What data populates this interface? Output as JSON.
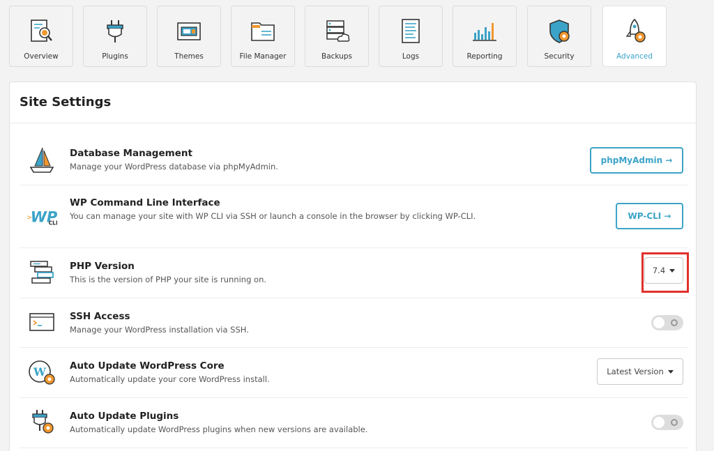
{
  "nav": {
    "tabs": [
      {
        "label": "Overview",
        "icon": "overview-icon"
      },
      {
        "label": "Plugins",
        "icon": "plugin-icon"
      },
      {
        "label": "Themes",
        "icon": "themes-icon"
      },
      {
        "label": "File Manager",
        "icon": "folder-icon"
      },
      {
        "label": "Backups",
        "icon": "backup-icon"
      },
      {
        "label": "Logs",
        "icon": "logs-icon"
      },
      {
        "label": "Reporting",
        "icon": "chart-icon"
      },
      {
        "label": "Security",
        "icon": "shield-icon"
      },
      {
        "label": "Advanced",
        "icon": "rocket-icon",
        "active": true
      }
    ]
  },
  "panel": {
    "title": "Site Settings",
    "rows": [
      {
        "title": "Database Management",
        "desc": "Manage your WordPress database via phpMyAdmin.",
        "action": "phpMyAdmin →"
      },
      {
        "title": "WP Command Line Interface",
        "desc": "You can manage your site with WP CLI via SSH or launch a console in the browser by clicking WP-CLI.",
        "action": "WP-CLI →"
      },
      {
        "title": "PHP Version",
        "desc": "This is the version of PHP your site is running on.",
        "value": "7.4"
      },
      {
        "title": "SSH Access",
        "desc": "Manage your WordPress installation via SSH.",
        "toggle": "off"
      },
      {
        "title": "Auto Update WordPress Core",
        "desc": "Automatically update your core WordPress install.",
        "value": "Latest Version"
      },
      {
        "title": "Auto Update Plugins",
        "desc": "Automatically update WordPress plugins when new versions are available.",
        "toggle": "off"
      }
    ]
  },
  "colors": {
    "accent": "#3ba3c7",
    "orange": "#f0962e",
    "highlight": "#e0302a"
  }
}
